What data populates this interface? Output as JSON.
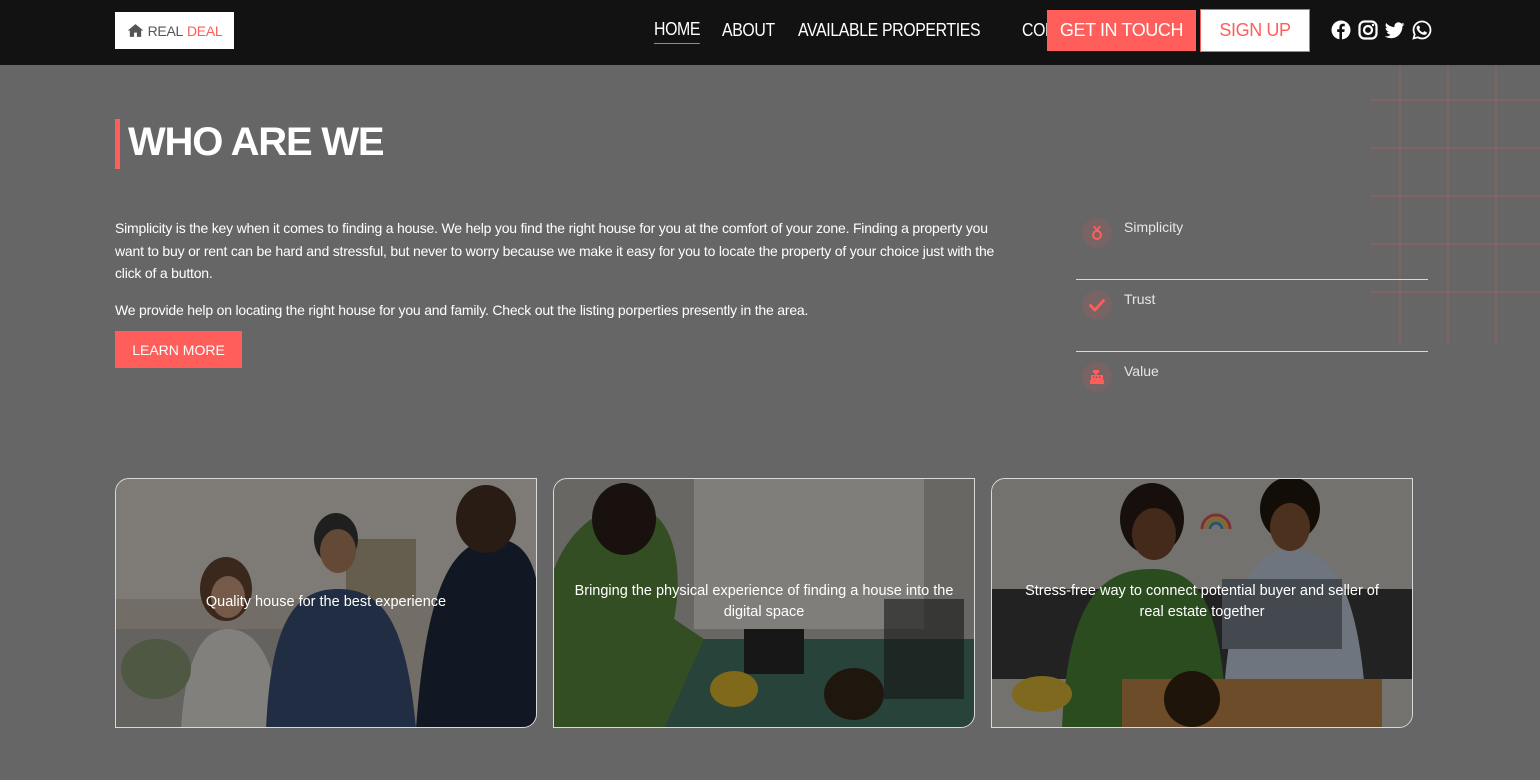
{
  "brand": {
    "part1": "REAL",
    "part2": "DEAL",
    "accent": "#ff5e5b"
  },
  "nav": {
    "links": [
      {
        "label": "HOME",
        "active": true
      },
      {
        "label": "ABOUT"
      },
      {
        "label": "AVAILABLE PROPERTIES"
      },
      {
        "label": "CONTACT"
      }
    ],
    "get_in_touch": "GET IN TOUCH",
    "sign_up": "SIGN UP",
    "socials": [
      "facebook-icon",
      "instagram-icon",
      "twitter-icon",
      "whatsapp-icon"
    ]
  },
  "about": {
    "title": "WHO ARE WE",
    "paragraph1": "Simplicity is the key when it comes to finding a house. We help you find the right house for you at the comfort of your zone. Finding a property you want to buy or rent can be hard and stressful, but never to worry because we make it easy for you to locate the property of your choice just with the click of a button.",
    "paragraph2": "We provide help on locating the right house for you and family. Check out the listing porperties presently in the area.",
    "button": "LEARN MORE"
  },
  "values": [
    {
      "label": "Simplicity",
      "icon": "medal-icon"
    },
    {
      "label": "Trust",
      "icon": "check-icon"
    },
    {
      "label": "Value",
      "icon": "cash-register-icon"
    }
  ],
  "cards": [
    {
      "caption": "Quality house for the best experience"
    },
    {
      "caption": "Bringing the physical experience of finding a house into the digital space"
    },
    {
      "caption": "Stress-free way to connect potential buyer and seller of real estate together"
    }
  ]
}
